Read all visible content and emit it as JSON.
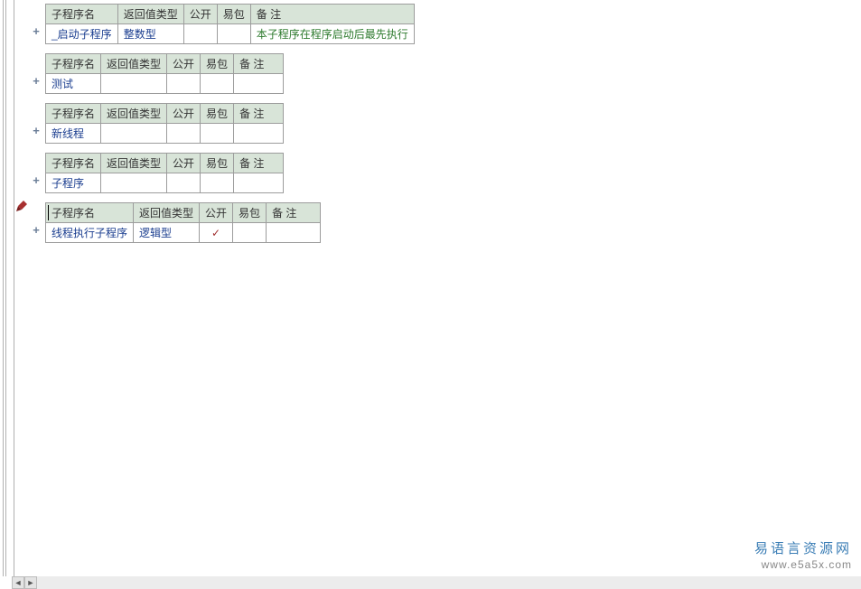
{
  "columns": {
    "name": "子程序名",
    "returnType": "返回值类型",
    "public": "公开",
    "package": "易包",
    "remark": "备 注"
  },
  "sections": [
    {
      "name": "_启动子程序",
      "returnType": "整数型",
      "public": "",
      "package": "",
      "remark": "本子程序在程序启动后最先执行",
      "remarkClass": "note"
    },
    {
      "name": "测试",
      "returnType": "",
      "public": "",
      "package": "",
      "remark": ""
    },
    {
      "name": "新线程",
      "returnType": "",
      "public": "",
      "package": "",
      "remark": ""
    },
    {
      "name": "子程序",
      "returnType": "",
      "public": "",
      "package": "",
      "remark": ""
    },
    {
      "name": "线程执行子程序",
      "returnType": "逻辑型",
      "public": "✓",
      "package": "",
      "remark": "",
      "editing": true
    }
  ],
  "watermark": {
    "line1": "易语言资源网",
    "line2": "www.e5a5x.com"
  },
  "icons": {
    "plus": "+",
    "arrowLeft": "◄",
    "arrowRight": "►"
  }
}
